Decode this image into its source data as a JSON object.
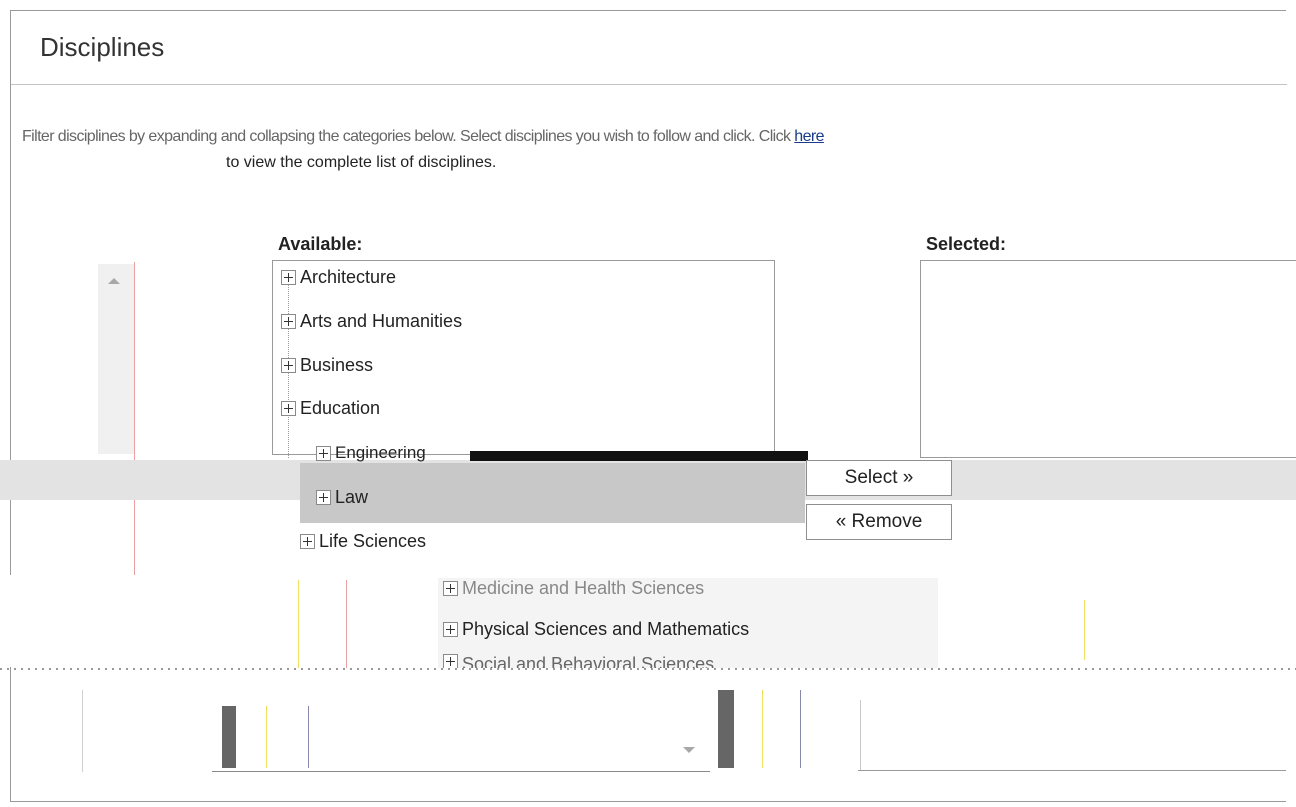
{
  "page": {
    "title": "Disciplines",
    "intro_line1": "Filter disciplines by expanding and collapsing the categories below. Select disciplines you wish to follow and click. Click ",
    "intro_link": "here",
    "intro_line2": "to view the complete list of disciplines."
  },
  "available": {
    "label": "Available:",
    "items": [
      "Architecture",
      "Arts and Humanities",
      "Business",
      "Education",
      "Engineering",
      "Law",
      "Life Sciences",
      "Medicine and Health Sciences",
      "Physical Sciences and Mathematics",
      "Social and Behavioral Sciences"
    ]
  },
  "selected": {
    "label": "Selected:"
  },
  "buttons": {
    "select": "Select »",
    "remove": "« Remove"
  },
  "icons": {
    "expand": "plus-expander-icon",
    "scroll_up": "scroll-up-arrow-icon",
    "dropdown": "chevron-down-icon"
  }
}
